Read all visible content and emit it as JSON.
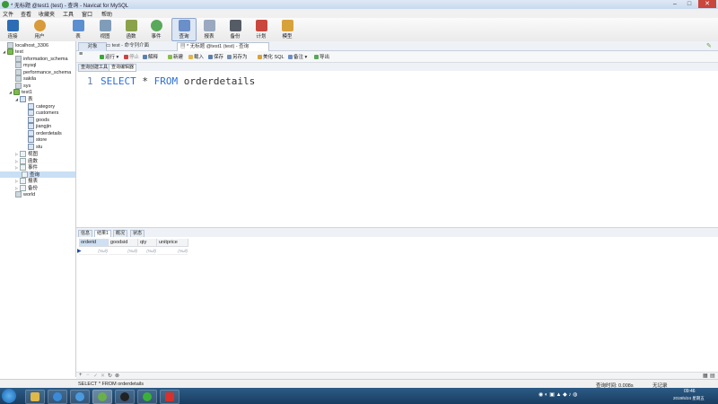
{
  "window": {
    "title": "* 无标题 @test1 (test) - 查询 - Navicat for MySQL"
  },
  "menu": [
    "文件",
    "查看",
    "收藏夹",
    "工具",
    "窗口",
    "帮助"
  ],
  "toolbar": [
    {
      "label": "连接",
      "icon": "connection-icon",
      "color": "#2d6db5"
    },
    {
      "label": "用户",
      "icon": "user-icon",
      "color": "#d89a3a"
    },
    {
      "label": "表",
      "icon": "table-icon",
      "color": "#5b8fd0"
    },
    {
      "label": "视图",
      "icon": "view-icon",
      "color": "#7f9db9"
    },
    {
      "label": "函数",
      "icon": "function-icon",
      "color": "#8aa24a"
    },
    {
      "label": "事件",
      "icon": "event-icon",
      "color": "#5aa85a"
    },
    {
      "label": "查询",
      "icon": "query-icon",
      "color": "#6a8fc9"
    },
    {
      "label": "报表",
      "icon": "report-icon",
      "color": "#9aa9bf"
    },
    {
      "label": "备份",
      "icon": "backup-icon",
      "color": "#555c66"
    },
    {
      "label": "计划",
      "icon": "schedule-icon",
      "color": "#c9473c"
    },
    {
      "label": "模型",
      "icon": "model-icon",
      "color": "#d8a23a"
    }
  ],
  "sidebar": {
    "items": [
      {
        "label": "localhost_3306",
        "level": 0,
        "type": "conn"
      },
      {
        "label": "test",
        "level": 0,
        "type": "conn"
      },
      {
        "label": "information_schema",
        "level": 1,
        "type": "gdb"
      },
      {
        "label": "mysql",
        "level": 1,
        "type": "gdb"
      },
      {
        "label": "performance_schema",
        "level": 1,
        "type": "gdb"
      },
      {
        "label": "sakila",
        "level": 1,
        "type": "gdb"
      },
      {
        "label": "sys",
        "level": 1,
        "type": "gdb"
      },
      {
        "label": "test1",
        "level": 1,
        "type": "db"
      },
      {
        "label": "表",
        "level": 2,
        "type": "folder"
      },
      {
        "label": "category",
        "level": 3,
        "type": "tbl"
      },
      {
        "label": "customers",
        "level": 3,
        "type": "tbl"
      },
      {
        "label": "goods",
        "level": 3,
        "type": "tbl"
      },
      {
        "label": "jiangjin",
        "level": 3,
        "type": "tbl"
      },
      {
        "label": "orderdetails",
        "level": 3,
        "type": "tbl"
      },
      {
        "label": "store",
        "level": 3,
        "type": "tbl"
      },
      {
        "label": "stu",
        "level": 3,
        "type": "tbl"
      },
      {
        "label": "视图",
        "level": 2,
        "type": "folder"
      },
      {
        "label": "函数",
        "level": 2,
        "type": "folder"
      },
      {
        "label": "事件",
        "level": 2,
        "type": "folder"
      },
      {
        "label": "查询",
        "level": 2,
        "type": "folder",
        "selected": true
      },
      {
        "label": "报表",
        "level": 2,
        "type": "folder"
      },
      {
        "label": "备份",
        "level": 2,
        "type": "folder"
      },
      {
        "label": "world",
        "level": 1,
        "type": "gdb"
      }
    ]
  },
  "tabs": {
    "objects": "对象",
    "query_tab1": "test - 命令列介面",
    "query_tab2": "* 无标题 @test1 (test) - 查询"
  },
  "query_toolbar": {
    "run": "运行",
    "stop": "停止",
    "explain": "解释",
    "new": "新建",
    "load": "载入",
    "save": "保存",
    "save_as": "另存为",
    "beautify": "美化 SQL",
    "comment": "备注",
    "export": "导出"
  },
  "subtabs": [
    "查询创建工具",
    "查询编辑器"
  ],
  "editor": {
    "line_number": "1",
    "kw_select": "SELECT",
    "star": " * ",
    "kw_from": "FROM",
    "table": " orderdetails"
  },
  "result_tabs": [
    "信息",
    "结果1",
    "概况",
    "状态"
  ],
  "grid": {
    "columns": [
      "orderid",
      "goodsid",
      "qty",
      "unitprice"
    ],
    "row": [
      "(Null)",
      "(Null)",
      "(Null)",
      "(Null)"
    ]
  },
  "status": {
    "sql": "SELECT * FROM orderdetails",
    "query_time": "查询时间: 0.008s",
    "records": "无记录"
  },
  "taskbar": {
    "clock_time": "09:46",
    "clock_date": "2019/5/24 星期五"
  }
}
